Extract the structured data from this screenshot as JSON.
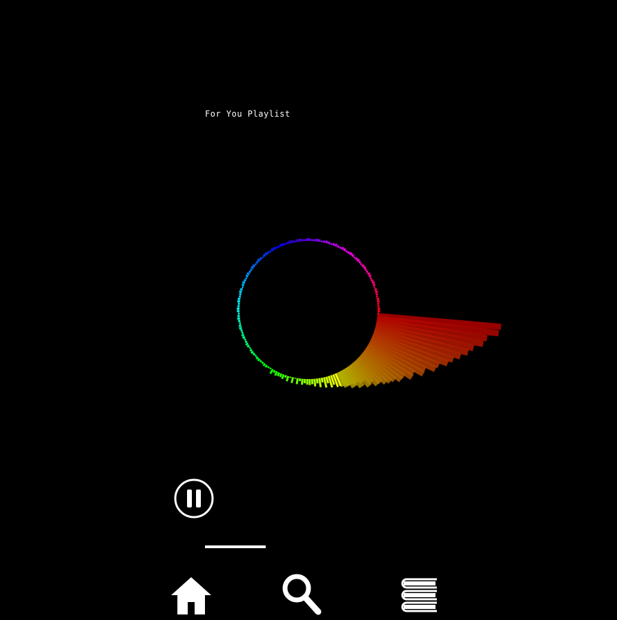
{
  "app": {
    "playlist_title": "For You Playlist"
  },
  "player": {
    "state": "playing",
    "control_icon": "pause-icon",
    "progress_fraction": 0.12
  },
  "visualizer": {
    "style": "circular-spectrum",
    "colors": [
      "#ff1a00",
      "#ff8c00",
      "#ffe600",
      "#33e000",
      "#00c8ff",
      "#2046ff",
      "#7a1fd6"
    ]
  },
  "nav": {
    "items": [
      {
        "icon": "home-icon",
        "active": true
      },
      {
        "icon": "search-icon",
        "active": false
      },
      {
        "icon": "library-icon",
        "active": false
      }
    ]
  }
}
